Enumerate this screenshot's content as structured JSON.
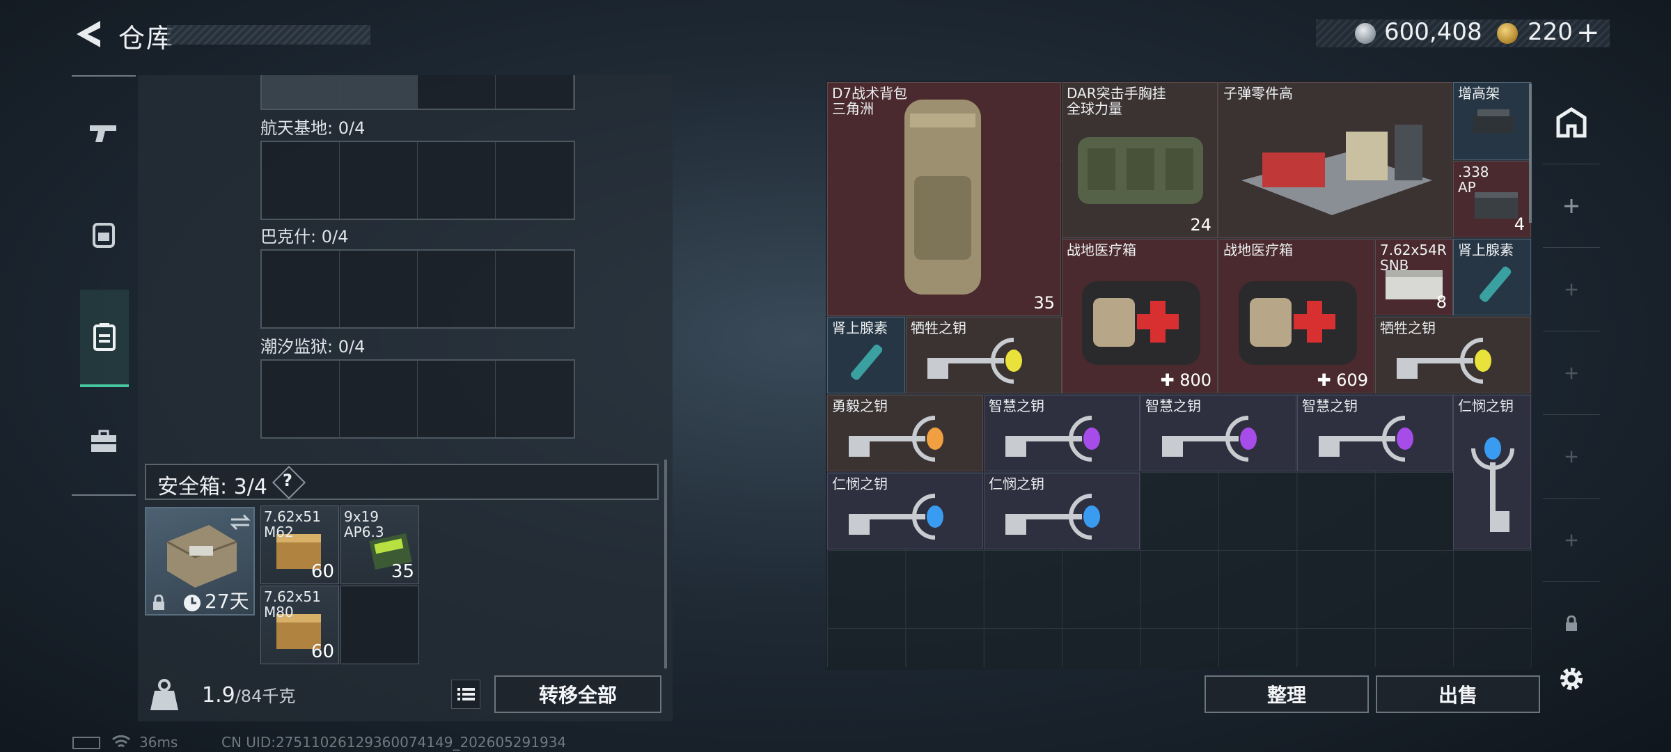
{
  "header": {
    "title": "仓库",
    "currency": {
      "coins": "600,408",
      "tokens": "220",
      "token_plus": "+"
    }
  },
  "left_nav": {
    "items": [
      {
        "icon": "gun-icon"
      },
      {
        "icon": "backpack-icon"
      },
      {
        "icon": "container-icon"
      },
      {
        "icon": "briefcase-icon"
      }
    ],
    "active": "container-icon"
  },
  "containers": {
    "groups": [
      {
        "label": "航天基地: 0/4"
      },
      {
        "label": "巴克什: 0/4"
      },
      {
        "label": "潮汐监狱: 0/4"
      }
    ]
  },
  "safebox": {
    "label": "安全箱: 3/4",
    "help": "?",
    "timer": "27天",
    "items": [
      {
        "name": "7.62x51\nM62",
        "count": "60"
      },
      {
        "name": "9x19\nAP6.3",
        "count": "35"
      },
      {
        "name": "7.62x51\nM80",
        "count": "60"
      },
      {
        "name": "",
        "count": ""
      }
    ]
  },
  "bottom_left": {
    "weight": "1.9",
    "weight_max": "/84千克",
    "transfer_all": "转移全部"
  },
  "stash": {
    "items": [
      {
        "id": "d7",
        "name": "D7战术背包\n三角洲",
        "count": "35"
      },
      {
        "id": "dar",
        "name": "DAR突击手胸挂\n全球力量",
        "count": "24"
      },
      {
        "id": "ammo-parts",
        "name": "子弹零件高",
        "count": ""
      },
      {
        "id": "riser",
        "name": "增高架",
        "count": ""
      },
      {
        "id": "338",
        "name": ".338\nAP",
        "count": "4"
      },
      {
        "id": "med1",
        "name": "战地医疗箱",
        "count": "800"
      },
      {
        "id": "med2",
        "name": "战地医疗箱",
        "count": "609"
      },
      {
        "id": "54r",
        "name": "7.62x54R\nSNB",
        "count": "8"
      },
      {
        "id": "adr1",
        "name": "肾上腺素",
        "count": ""
      },
      {
        "id": "adr2",
        "name": "肾上腺素",
        "count": ""
      },
      {
        "id": "key-sac1",
        "name": "牺牲之钥",
        "count": ""
      },
      {
        "id": "key-sac2",
        "name": "牺牲之钥",
        "count": ""
      },
      {
        "id": "key-brave",
        "name": "勇毅之钥",
        "count": ""
      },
      {
        "id": "key-wis1",
        "name": "智慧之钥",
        "count": ""
      },
      {
        "id": "key-wis2",
        "name": "智慧之钥",
        "count": ""
      },
      {
        "id": "key-wis3",
        "name": "智慧之钥",
        "count": ""
      },
      {
        "id": "key-mercy1",
        "name": "仁悯之钥",
        "count": ""
      },
      {
        "id": "key-mercy2",
        "name": "仁悯之钥",
        "count": ""
      },
      {
        "id": "key-mercy3",
        "name": "仁悯之钥",
        "count": ""
      }
    ],
    "sort": "整理",
    "sell": "出售"
  },
  "footer": {
    "ping": "36ms",
    "uid": "CN UID:27511026129360074149_202605291934"
  },
  "colors": {
    "accent": "#47c7a0",
    "key_yellow": "#e8e23a",
    "key_orange": "#f0a040",
    "key_purple": "#a64ce8",
    "key_blue": "#3a9cf0"
  }
}
